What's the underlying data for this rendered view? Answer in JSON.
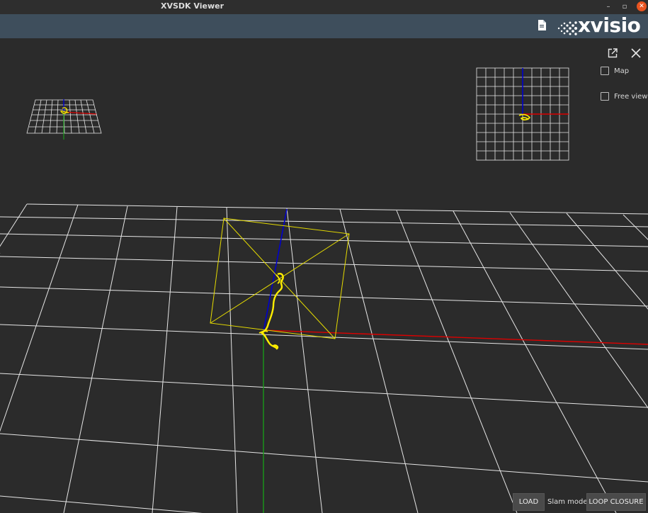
{
  "window": {
    "title": "XVSDK Viewer",
    "minimize_glyph": "–",
    "maximize_glyph": "▫",
    "close_glyph": "✕"
  },
  "header": {
    "document_icon": "document-icon",
    "logo_text": "xvisio"
  },
  "viewport": {
    "popout_icon": "open-in-new-icon",
    "close_icon": "close-icon",
    "checkboxes": [
      {
        "label": "Map",
        "checked": false
      },
      {
        "label": "Free view",
        "checked": false
      }
    ]
  },
  "footer": {
    "load_label": "LOAD",
    "slam_mode_label": "Slam mode",
    "loop_closure_label": "LOOP CLOSURE"
  },
  "colors": {
    "background": "#2b2b2b",
    "header": "#3e4e5c",
    "x_axis": "#dd0000",
    "y_axis": "#1a9a1a",
    "z_axis": "#0000cc",
    "trajectory": "#ffee00",
    "grid": "#e6e6e6"
  }
}
